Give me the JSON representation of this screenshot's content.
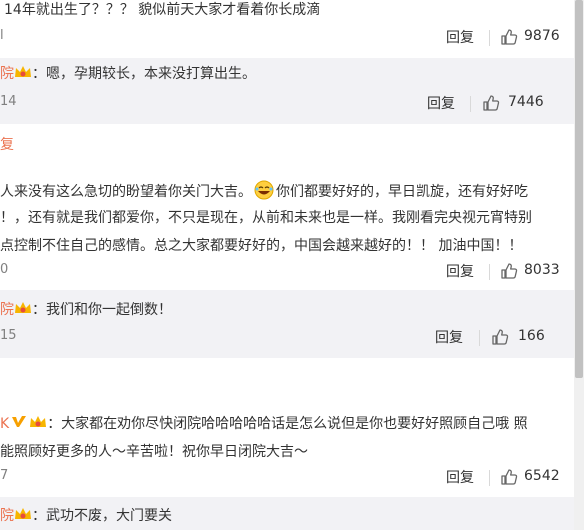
{
  "comments": [
    {
      "text": "14年就出生了？？？ 貌似前天大家才看着你长成滴",
      "time_fragment": "l",
      "reply_label": "回复",
      "likes": "9876"
    },
    {
      "author_fragment": "院",
      "text": "：嗯，孕期较长，本来没打算出生。",
      "time_fragment": "14",
      "reply_label": "回复",
      "likes": "7446",
      "more_link": "复"
    },
    {
      "text_lines": [
        "人来没有这么急切的盼望着你关门大吉。",
        "你们都要好好的，早日凯旋，还有好好吃",
        "！，还有就是我们都爱你，不只是现在，从前和未来也是一样。我刚看完央视元宵特别",
        "点控制不住自己的感情。总之大家都要好好的，中国会越来越好的！！ 加油中国！！"
      ],
      "time_fragment": "0",
      "reply_label": "回复",
      "likes": "8033"
    },
    {
      "author_fragment": "院",
      "text": "：我们和你一起倒数！",
      "time_fragment": "15",
      "reply_label": "回复",
      "likes": "166"
    },
    {
      "author_fragment": "K",
      "text_lines": [
        "：大家都在劝你尽快闭院哈哈哈哈哈话是怎么说但是你也要好好照顾自己哦 照",
        "能照顾好更多的人～辛苦啦！祝你早日闭院大吉～"
      ],
      "time_fragment": "7",
      "reply_label": "回复",
      "likes": "6542"
    },
    {
      "author_fragment": "院",
      "text": "：武功不废，大门要关"
    }
  ],
  "colors": {
    "reply_bg": "#f2f2f5",
    "accent_orange": "#eb7350",
    "text": "#333333",
    "scrollbar_thumb": "#c1c1c1"
  },
  "icons": [
    "thumb-up-icon",
    "laughing-emoji-icon",
    "verified-v-icon",
    "crown-badge-icon"
  ]
}
